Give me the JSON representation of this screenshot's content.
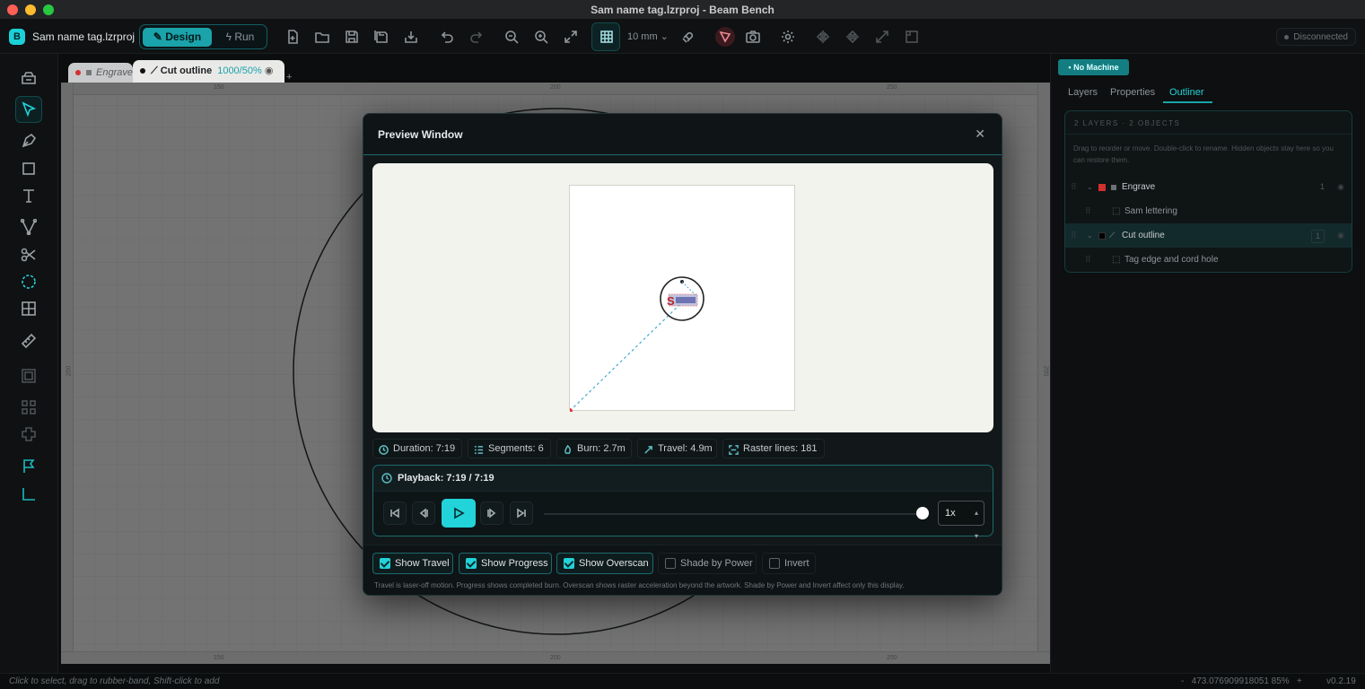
{
  "window": {
    "title": "Sam name tag.lzrproj - Beam Bench"
  },
  "toolbar": {
    "app_letter": "B",
    "project_name": "Sam name tag.lzrproj",
    "mode_design": "Design",
    "mode_run": "Run",
    "grid_size": "10 mm",
    "connection": "Disconnected"
  },
  "tabs": [
    {
      "label": "Engrave",
      "color": "#d32f2f"
    },
    {
      "label": "Cut outline",
      "meta": "1000/50%",
      "color": "#111111"
    }
  ],
  "rulers": {
    "top": [
      "150",
      "200",
      "250"
    ],
    "bottom": [
      "150",
      "200",
      "250"
    ],
    "left": "200",
    "right": "200"
  },
  "right_panel": {
    "machine": "No Machine",
    "tabs": [
      "Layers",
      "Properties",
      "Outliner"
    ],
    "active_tab": "Outliner",
    "outliner": {
      "header": "2 LAYERS · 2 OBJECTS",
      "hint": "Drag to reorder or move. Double-click to rename. Hidden objects stay here so you can restore them.",
      "rows": [
        {
          "name": "Engrave",
          "count": "1",
          "color": "#d32f2f",
          "type": "layer"
        },
        {
          "name": "Sam lettering",
          "type": "object"
        },
        {
          "name": "Cut outline",
          "count": "1",
          "color": "#000000",
          "type": "layer"
        },
        {
          "name": "Tag edge and cord hole",
          "type": "object"
        }
      ]
    }
  },
  "modal": {
    "title": "Preview Window",
    "stats": [
      {
        "label": "Duration: 7:19",
        "icon": "clock-icon"
      },
      {
        "label": "Segments: 6",
        "icon": "segments-icon"
      },
      {
        "label": "Burn: 2.7m",
        "icon": "flame-icon"
      },
      {
        "label": "Travel: 4.9m",
        "icon": "travel-icon"
      },
      {
        "label": "Raster lines: 181",
        "icon": "raster-icon"
      }
    ],
    "playback": {
      "title": "Playback: 7:19 / 7:19",
      "speed": "1x",
      "progress": 1.0
    },
    "options": [
      {
        "label": "Show Travel",
        "checked": true
      },
      {
        "label": "Show Progress",
        "checked": true
      },
      {
        "label": "Show Overscan",
        "checked": true
      },
      {
        "label": "Shade by Power",
        "checked": false
      },
      {
        "label": "Invert",
        "checked": false
      }
    ],
    "note": "Travel is laser-off motion. Progress shows completed burn. Overscan shows raster acceleration beyond the artwork. Shade by Power and Invert affect only this display."
  },
  "status": {
    "hint": "Click to select, drag to rubber-band, Shift-click to add",
    "zoom_minus": "-",
    "zoom": "473.076909918051 85%",
    "zoom_plus": "+",
    "version": "v0.2.19"
  },
  "colors": {
    "accent": "#22d3d9",
    "engrave": "#d32f2f"
  }
}
